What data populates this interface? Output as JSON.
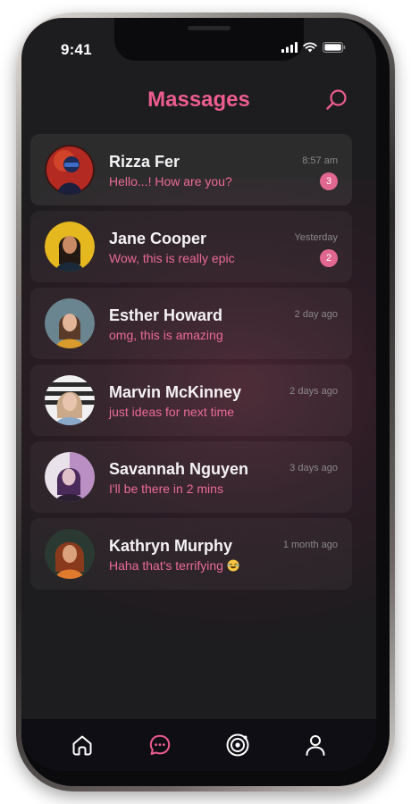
{
  "status_bar": {
    "time": "9:41"
  },
  "header": {
    "title": "Massages",
    "search_icon": "search-icon"
  },
  "colors": {
    "accent": "#ec5d8e",
    "background": "#1d1c1e",
    "badge": "#e0678f",
    "tab_active": "#ec5d8e",
    "tab_inactive": "#ffffff"
  },
  "chats": [
    {
      "name": "Rizza Fer",
      "preview": "Hello...! How are you?",
      "time": "8:57 am",
      "unread": "3"
    },
    {
      "name": "Jane Cooper",
      "preview": "Wow, this is really epic",
      "time": "Yesterday",
      "unread": "2"
    },
    {
      "name": "Esther Howard",
      "preview": "omg, this is amazing",
      "time": "2 day ago",
      "unread": null
    },
    {
      "name": "Marvin McKinney",
      "preview": "just ideas for next time",
      "time": "2 days ago",
      "unread": null
    },
    {
      "name": "Savannah Nguyen",
      "preview": "I'll be there in 2 mins",
      "time": "3 days ago",
      "unread": null
    },
    {
      "name": "Kathryn Murphy",
      "preview": "Haha that's terrifying",
      "time": "1 month ago",
      "unread": null,
      "emoji": "laughing-crying-emoji"
    }
  ],
  "tab_bar": {
    "tabs": [
      {
        "icon": "home-icon",
        "active": false
      },
      {
        "icon": "chat-bubble-icon",
        "active": true
      },
      {
        "icon": "radar-icon",
        "active": false
      },
      {
        "icon": "user-icon",
        "active": false
      }
    ]
  }
}
